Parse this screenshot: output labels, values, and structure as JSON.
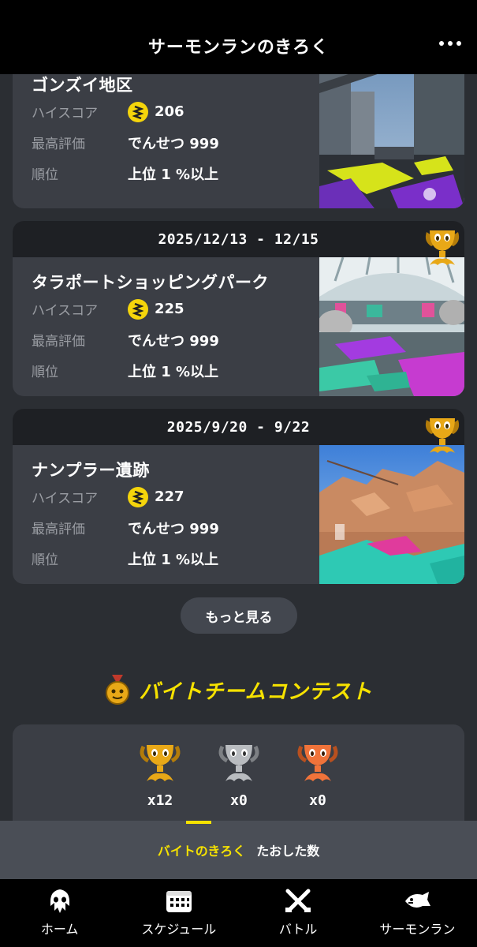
{
  "header": {
    "title": "サーモンランのきろく"
  },
  "records": [
    {
      "date": "",
      "stage": "ゴンズイ地区",
      "labels": {
        "score": "ハイスコア",
        "rating": "最高評価",
        "rank": "順位"
      },
      "score": "206",
      "rating": "でんせつ 999",
      "rank": "上位 1 %以上"
    },
    {
      "date": "2025/12/13 - 12/15",
      "stage": "タラポートショッピングパーク",
      "labels": {
        "score": "ハイスコア",
        "rating": "最高評価",
        "rank": "順位"
      },
      "score": "225",
      "rating": "でんせつ 999",
      "rank": "上位 1 %以上"
    },
    {
      "date": "2025/9/20 - 9/22",
      "stage": "ナンプラー遺跡",
      "labels": {
        "score": "ハイスコア",
        "rating": "最高評価",
        "rank": "順位"
      },
      "score": "227",
      "rating": "でんせつ 999",
      "rank": "上位 1 %以上"
    }
  ],
  "more_button": "もっと見る",
  "contest": {
    "title": "バイトチームコンテスト",
    "medals": [
      {
        "kind": "gold",
        "count": "x12",
        "color": "#e8a817"
      },
      {
        "kind": "silver",
        "count": "x0",
        "color": "#b9bcc0"
      },
      {
        "kind": "bronze",
        "count": "x0",
        "color": "#f0733a"
      }
    ]
  },
  "subtabs": [
    {
      "label": "バイトのきろく",
      "active": true
    },
    {
      "label": "たおした数",
      "active": false
    }
  ],
  "nav": [
    {
      "label": "ホーム",
      "icon": "squid-icon"
    },
    {
      "label": "スケジュール",
      "icon": "calendar-icon"
    },
    {
      "label": "バトル",
      "icon": "crossed-weapons-icon"
    },
    {
      "label": "サーモンラン",
      "icon": "salmon-icon"
    }
  ],
  "colors": {
    "accent": "#f6e200",
    "background": "#2b2e33",
    "card": "#3b3e45",
    "egg": "#f5d50b",
    "trophy_gold": "#e8a817"
  }
}
